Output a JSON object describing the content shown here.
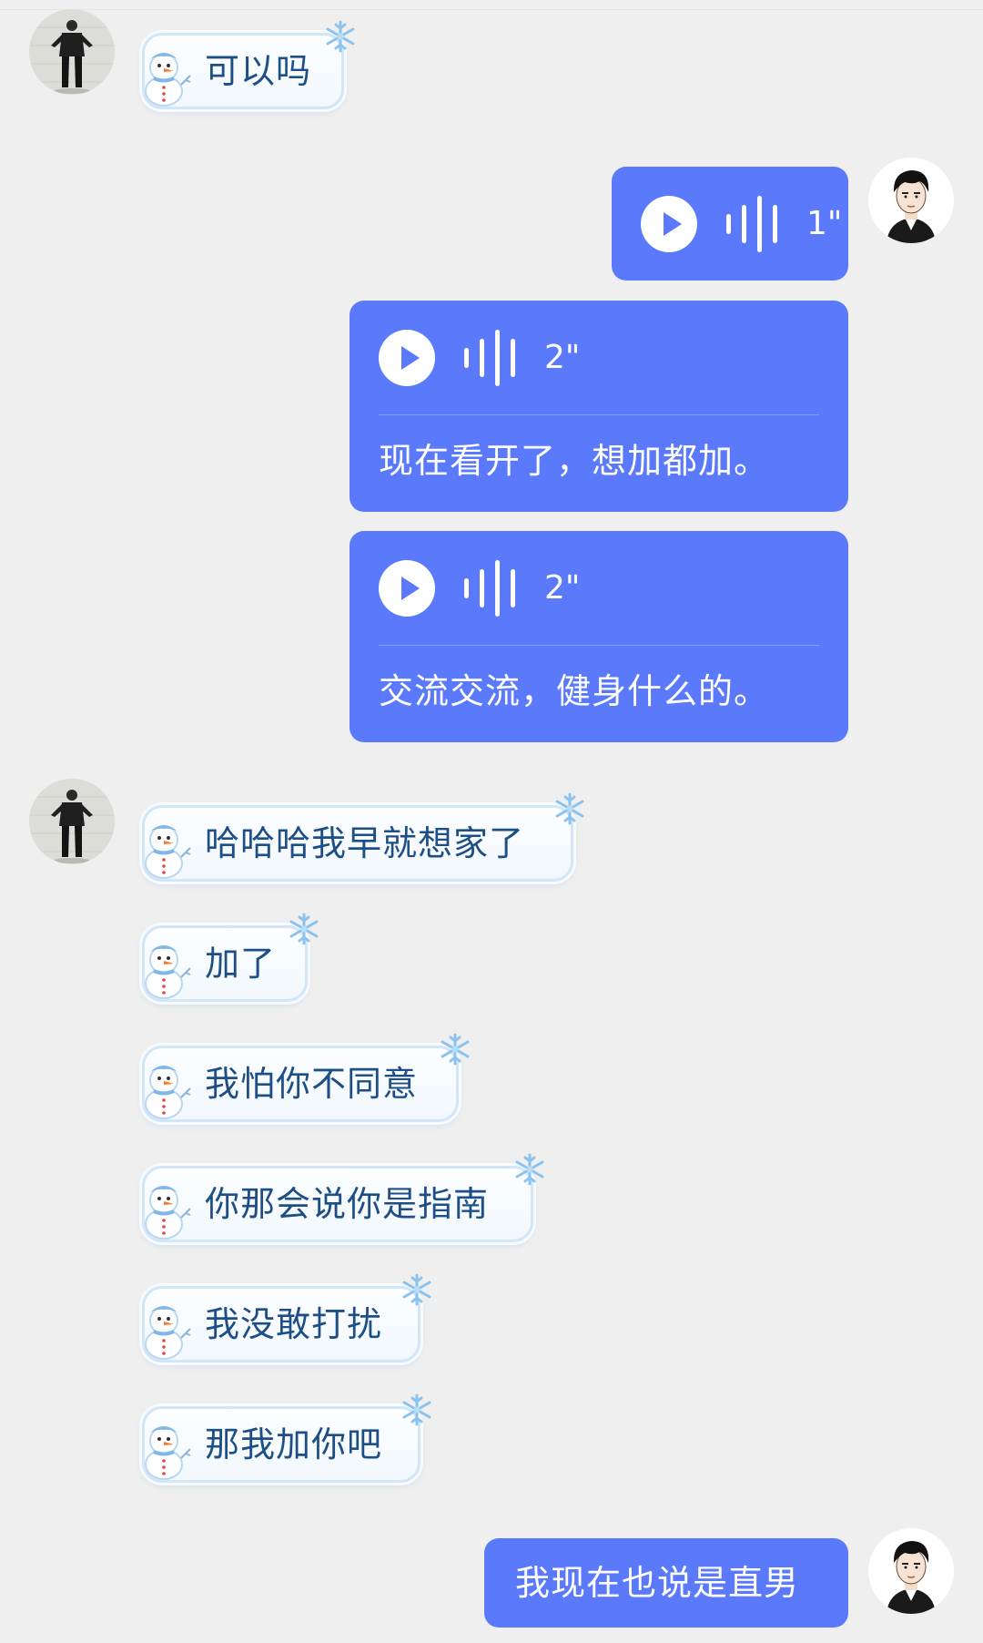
{
  "colors": {
    "background": "#efefef",
    "sent_bubble": "#5a79fb",
    "received_text": "#1d4f86",
    "bubble_border": "#d2e6f8"
  },
  "messages": [
    {
      "side": "left",
      "kind": "text",
      "text": "可以吗"
    },
    {
      "side": "right",
      "kind": "voice",
      "duration": "1\""
    },
    {
      "side": "right",
      "kind": "voice-transcript",
      "duration": "2\"",
      "transcript": "现在看开了，想加都加。"
    },
    {
      "side": "right",
      "kind": "voice-transcript",
      "duration": "2\"",
      "transcript": "交流交流，健身什么的。"
    },
    {
      "side": "left",
      "kind": "text",
      "text": "哈哈哈我早就想家了"
    },
    {
      "side": "left",
      "kind": "text",
      "text": "加了"
    },
    {
      "side": "left",
      "kind": "text",
      "text": "我怕你不同意"
    },
    {
      "side": "left",
      "kind": "text",
      "text": "你那会说你是指南"
    },
    {
      "side": "left",
      "kind": "text",
      "text": "我没敢打扰"
    },
    {
      "side": "left",
      "kind": "text",
      "text": "那我加你吧"
    },
    {
      "side": "right",
      "kind": "text",
      "text": "我现在也说是直男"
    }
  ]
}
